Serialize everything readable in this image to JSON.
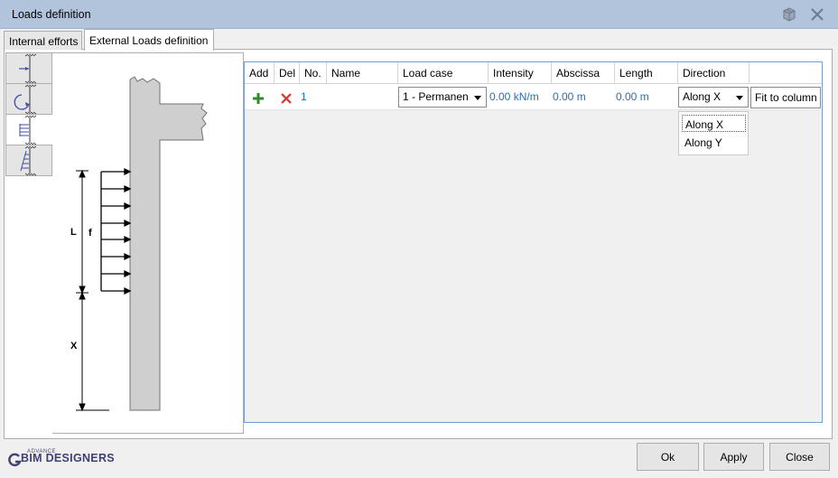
{
  "window": {
    "title": "Loads definition"
  },
  "tabs": [
    {
      "label": "Internal efforts"
    },
    {
      "label": "External Loads definition"
    }
  ],
  "sketch": {
    "label_l": "L",
    "label_f": "f",
    "label_x": "X"
  },
  "grid": {
    "columns": [
      "Add",
      "Del",
      "No.",
      "Name",
      "Load case",
      "Intensity",
      "Abscissa",
      "Length",
      "Direction"
    ],
    "rows": [
      {
        "no": "1",
        "name": "",
        "load_case": "1 - Permanen",
        "intensity": "0.00 kN/m",
        "abscissa": "0.00 m",
        "length": "0.00 m",
        "direction": "Along X",
        "action": "Fit to column"
      }
    ],
    "direction_options": [
      "Along X",
      "Along Y"
    ]
  },
  "footer": {
    "logo_small": "ADVANCE",
    "logo_main": "BIM DESIGNERS",
    "ok": "Ok",
    "apply": "Apply",
    "close": "Close"
  },
  "colors": {
    "titlebar": "#b1c4dc",
    "add_icon": "#2e8b2e",
    "del_icon": "#d9342b",
    "value_text": "#2a6cb3"
  }
}
